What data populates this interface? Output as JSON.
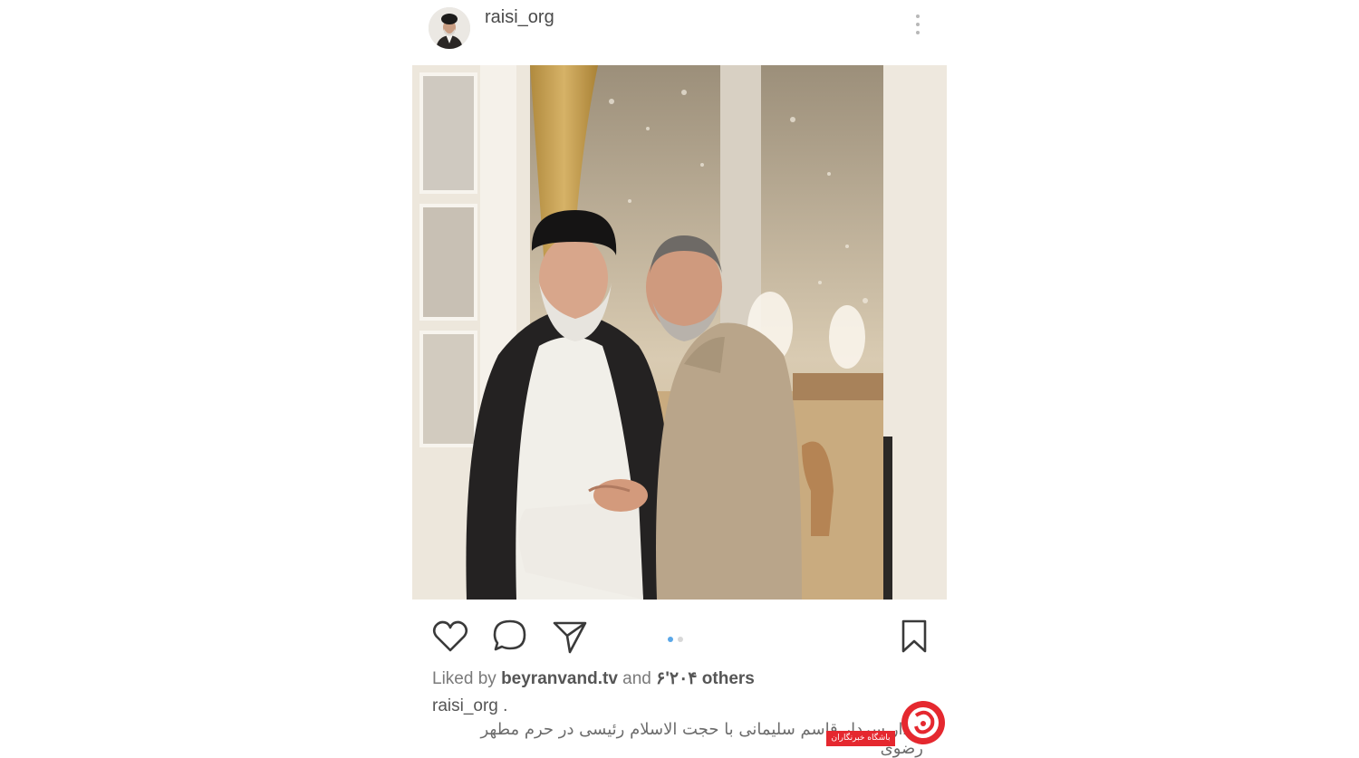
{
  "post": {
    "username": "raisi_org",
    "avatar_icon": "profile-avatar",
    "more_icon": "vertical-ellipsis-icon",
    "carousel": {
      "count": 2,
      "active_index": 0
    },
    "actions": {
      "like_icon": "heart-icon",
      "comment_icon": "comment-icon",
      "share_icon": "send-icon",
      "save_icon": "bookmark-icon"
    },
    "likes": {
      "prefix": "Liked by",
      "user": "beyranvand.tv",
      "middle": "and",
      "count": "۶'۲۰۴",
      "suffix": "others"
    },
    "caption": {
      "user": "raisi_org .",
      "text": "دیدار سردار قاسم سلیمانی با حجت الاسلام رئیسی در حرم مطهر رضوی"
    }
  },
  "watermark": {
    "label": "باشگاه خبرنگاران",
    "logo_icon": "news-logo"
  },
  "colors": {
    "accent_dot": "#5aa7e8",
    "watermark_red": "#e5282f"
  }
}
